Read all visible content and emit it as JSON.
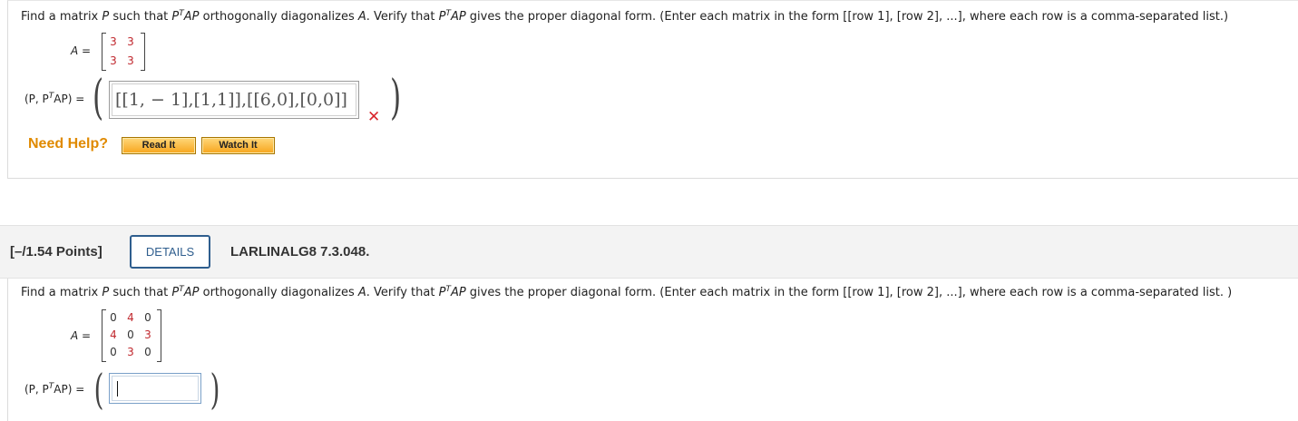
{
  "q1": {
    "prompt_parts": {
      "a": "Find a matrix ",
      "P": "P",
      "b": " such that ",
      "P2": "P",
      "T": "T",
      "AP": "AP",
      "c": " orthogonally diagonalizes ",
      "A": "A",
      "d": ". Verify that ",
      "P3": "P",
      "T2": "T",
      "AP2": "AP",
      "e": " gives the proper diagonal form. (Enter each matrix in the form [[row 1], [row 2], ...], where each row is a comma-separated list.)"
    },
    "a_label": "A =",
    "matrix": [
      [
        "3",
        "3"
      ],
      [
        "3",
        "3"
      ]
    ],
    "answer_label_prefix": "(P, P",
    "answer_label_T": "T",
    "answer_label_suffix": "AP) =",
    "answer_value": "[[1, − 1],[1,1]],[[6,0],[0,0]]",
    "status_icon": "incorrect-x-icon",
    "need_help": "Need Help?",
    "read_it": "Read It",
    "watch_it": "Watch It"
  },
  "header2": {
    "points": "[–/1.54 Points]",
    "details": "DETAILS",
    "code": "LARLINALG8 7.3.048."
  },
  "q2": {
    "prompt_parts": {
      "a": "Find a matrix ",
      "P": "P",
      "b": " such that ",
      "P2": "P",
      "T": "T",
      "AP": "AP",
      "c": " orthogonally diagonalizes ",
      "A": "A",
      "d": ". Verify that ",
      "P3": "P",
      "T2": "T",
      "AP2": "AP",
      "e": " gives the proper diagonal form. (Enter each matrix in the form [[row 1], [row 2], ...], where each row is a comma-separated list. )"
    },
    "a_label": "A =",
    "matrix": [
      [
        "0",
        "4",
        "0"
      ],
      [
        "4",
        "0",
        "3"
      ],
      [
        "0",
        "3",
        "0"
      ]
    ],
    "answer_label_prefix": "(P, P",
    "answer_label_T": "T",
    "answer_label_suffix": "AP) =",
    "answer_value": ""
  },
  "colors": {
    "accent_orange": "#e08a00",
    "matrix_red": "#c0282e",
    "details_blue": "#2f5e8e",
    "error_red": "#d9262c"
  }
}
